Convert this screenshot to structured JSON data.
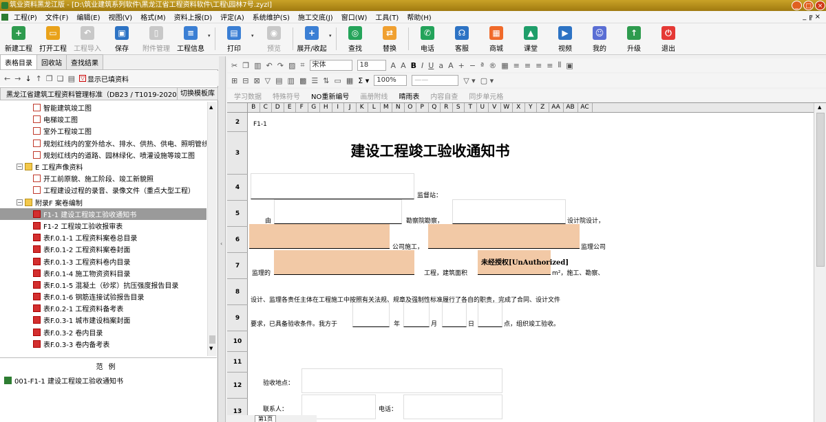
{
  "window": {
    "title": "筑业资料黑龙江版 - [D:\\筑业建筑系列软件\\黑龙江省工程资料软件\\工程\\园林7号.zyzl]",
    "controls": [
      "_",
      "□",
      "×"
    ]
  },
  "menu": [
    "工程(P)",
    "文件(F)",
    "编辑(E)",
    "视图(V)",
    "格式(M)",
    "资料上报(D)",
    "评定(A)",
    "系统维护(S)",
    "施工交底(J)",
    "窗口(W)",
    "工具(T)",
    "帮助(H)"
  ],
  "mdi_controls": "_ ╔ ×",
  "toolbar": [
    {
      "label": "新建工程",
      "icon": "new-project-icon",
      "color": "#2e9b4e",
      "glyph": "+"
    },
    {
      "label": "打开工程",
      "icon": "open-folder-icon",
      "color": "#e9a21a",
      "glyph": "▭"
    },
    {
      "label": "工程导入",
      "icon": "import-icon",
      "color": "#bbbbbb",
      "glyph": "↶",
      "disabled": true
    },
    {
      "label": "保存",
      "icon": "save-icon",
      "color": "#2d73c4",
      "glyph": "▣"
    },
    {
      "label": "附件管理",
      "icon": "attachment-icon",
      "color": "#bbbbbb",
      "glyph": "▯",
      "disabled": true
    },
    {
      "label": "工程信息",
      "icon": "project-info-icon",
      "color": "#3b7fd4",
      "glyph": "≡"
    },
    {
      "label": "打印",
      "icon": "print-icon",
      "color": "#3b7fd4",
      "glyph": "▤"
    },
    {
      "label": "预览",
      "icon": "preview-icon",
      "color": "#bbbbbb",
      "glyph": "◉",
      "disabled": true
    },
    {
      "label": "展开/收起",
      "icon": "expand-icon",
      "color": "#3b7fd4",
      "glyph": "+"
    },
    {
      "label": "查找",
      "icon": "search-icon",
      "color": "#25a45a",
      "glyph": "◎"
    },
    {
      "label": "替换",
      "icon": "replace-icon",
      "color": "#f0a030",
      "glyph": "⇄"
    },
    {
      "label": "电话",
      "icon": "phone-icon",
      "color": "#23a35a",
      "glyph": "✆"
    },
    {
      "label": "客服",
      "icon": "support-icon",
      "color": "#2d73c4",
      "glyph": "☊"
    },
    {
      "label": "商城",
      "icon": "shop-icon",
      "color": "#f06a2a",
      "glyph": "▦"
    },
    {
      "label": "课堂",
      "icon": "class-icon",
      "color": "#1f9e6a",
      "glyph": "▲"
    },
    {
      "label": "视频",
      "icon": "video-icon",
      "color": "#2d73c4",
      "glyph": "▶"
    },
    {
      "label": "我的",
      "icon": "user-icon",
      "color": "#5a6ed4",
      "glyph": "☺"
    },
    {
      "label": "升级",
      "icon": "upgrade-icon",
      "color": "#2e9b4e",
      "glyph": "↑"
    },
    {
      "label": "退出",
      "icon": "exit-icon",
      "color": "#e53935",
      "glyph": "⏻"
    }
  ],
  "left": {
    "tabs": [
      "表格目录",
      "回收站",
      "查找结果"
    ],
    "show_filled": "显示已填资料",
    "standard": "黑龙江省建筑工程资料管理标准（DB23 / T1019-2020）",
    "switch_template": "切换模板库",
    "tree": [
      {
        "label": "智能建筑竣工图",
        "type": "doc",
        "level": 2
      },
      {
        "label": "电梯竣工图",
        "type": "doc",
        "level": 2
      },
      {
        "label": "室外工程竣工图",
        "type": "doc",
        "level": 2
      },
      {
        "label": "规划红线内的室外给水、排水、供热、供电、照明管线",
        "type": "doc",
        "level": 2
      },
      {
        "label": "规划红线内的道路、园林绿化、喷灌设施等竣工图",
        "type": "doc",
        "level": 2
      },
      {
        "label": "E 工程声像资料",
        "type": "folder",
        "level": 1
      },
      {
        "label": "开工前原貌、施工阶段、竣工新貌照",
        "type": "doc",
        "level": 2
      },
      {
        "label": "工程建设过程的录音、录像文件（重点大型工程）",
        "type": "doc",
        "level": 2
      },
      {
        "label": "附录F 案卷编制",
        "type": "folder",
        "level": 1
      },
      {
        "label": "F1-1 建设工程竣工验收通知书",
        "type": "xls",
        "level": 2,
        "selected": true
      },
      {
        "label": "F1-2 工程竣工验收报审表",
        "type": "xls",
        "level": 2
      },
      {
        "label": "表F.0.1-1 工程资料案卷总目录",
        "type": "xls",
        "level": 2
      },
      {
        "label": "表F.0.1-2 工程资料案卷封面",
        "type": "xls",
        "level": 2
      },
      {
        "label": "表F.0.1-3 工程资料卷内目录",
        "type": "xls",
        "level": 2
      },
      {
        "label": "表F.0.1-4 施工物资资料目录",
        "type": "xls",
        "level": 2
      },
      {
        "label": "表F.0.1-5 混凝土（砂浆）抗压强度报告目录",
        "type": "xls",
        "level": 2
      },
      {
        "label": "表F.0.1-6 钢筋连接试验报告目录",
        "type": "xls",
        "level": 2
      },
      {
        "label": "表F.0.2-1 工程资料备考表",
        "type": "xls",
        "level": 2
      },
      {
        "label": "表F.0.3-1 城市建设档案封面",
        "type": "xls",
        "level": 2
      },
      {
        "label": "表F.0.3-2 卷内目录",
        "type": "xls",
        "level": 2
      },
      {
        "label": "表F.0.3-3 卷内备考表",
        "type": "xls",
        "level": 2
      }
    ],
    "example_title": "范例",
    "example_item": "001-F1-1 建设工程竣工验收通知书"
  },
  "editor": {
    "font_name": "宋体",
    "font_size": "18",
    "zoom": "100%",
    "tb3": [
      "学习数据",
      "特殊符号",
      "NO重新编号",
      "画册附线",
      "晴雨表",
      "内容自查",
      "同步单元格"
    ],
    "columns": [
      "B",
      "C",
      "D",
      "E",
      "F",
      "G",
      "H",
      "I",
      "J",
      "K",
      "L",
      "M",
      "N",
      "O",
      "P",
      "Q",
      "R",
      "S",
      "T",
      "U",
      "V",
      "W",
      "X",
      "Y",
      "Z",
      "AA",
      "AB",
      "AC"
    ],
    "sheet_tab": "第1页"
  },
  "form": {
    "code": "F1-1",
    "title": "建设工程竣工验收通知书",
    "r4_label": "监督站：",
    "r5_a": "由",
    "r5_b": "勘察院勘察，",
    "r5_c": "设计院设计，",
    "r6_a": "公司施工，",
    "r6_b": "监理公司",
    "r7_a": "监理的",
    "r7_b": "工程，建筑面积",
    "r7_c": "m²，施工、勘察、",
    "watermark": "未经授权[UnAuthorized]",
    "r8": "设计、监理各责任主体在工程施工中按照有关法规、规章及强制性标准履行了各自的职责，完成了合同、设计文件",
    "r9_a": "要求，已具备验收条件。我方于",
    "r9_y": "年",
    "r9_m": "月",
    "r9_d": "日",
    "r9_h": "点，组织竣工验收。",
    "r12": "验收地点：",
    "r13_a": "联系人：",
    "r13_b": "电话：",
    "row_numbers": [
      "2",
      "3",
      "4",
      "5",
      "6",
      "7",
      "8",
      "9",
      "10",
      "11",
      "12",
      "13"
    ]
  }
}
